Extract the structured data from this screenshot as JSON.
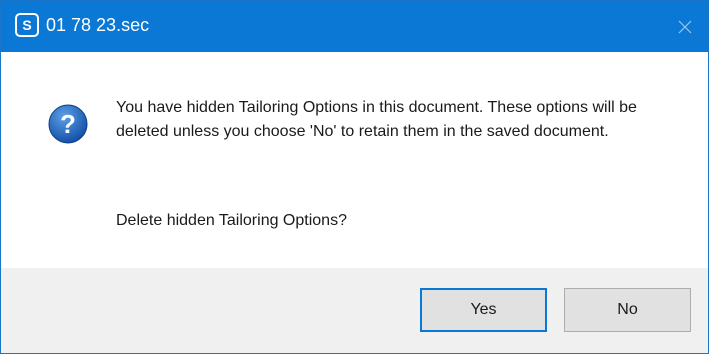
{
  "window": {
    "title": "01 78 23.sec",
    "app_icon": "spec-app-icon",
    "close_icon": "close-icon",
    "accent": "#0a78d4"
  },
  "message": {
    "icon": "question-icon",
    "body": "You have hidden Tailoring Options in this document. These options will be deleted unless you choose 'No' to retain them in the saved document.",
    "prompt": "Delete hidden Tailoring Options?"
  },
  "buttons": {
    "yes_label": "Yes",
    "no_label": "No"
  }
}
